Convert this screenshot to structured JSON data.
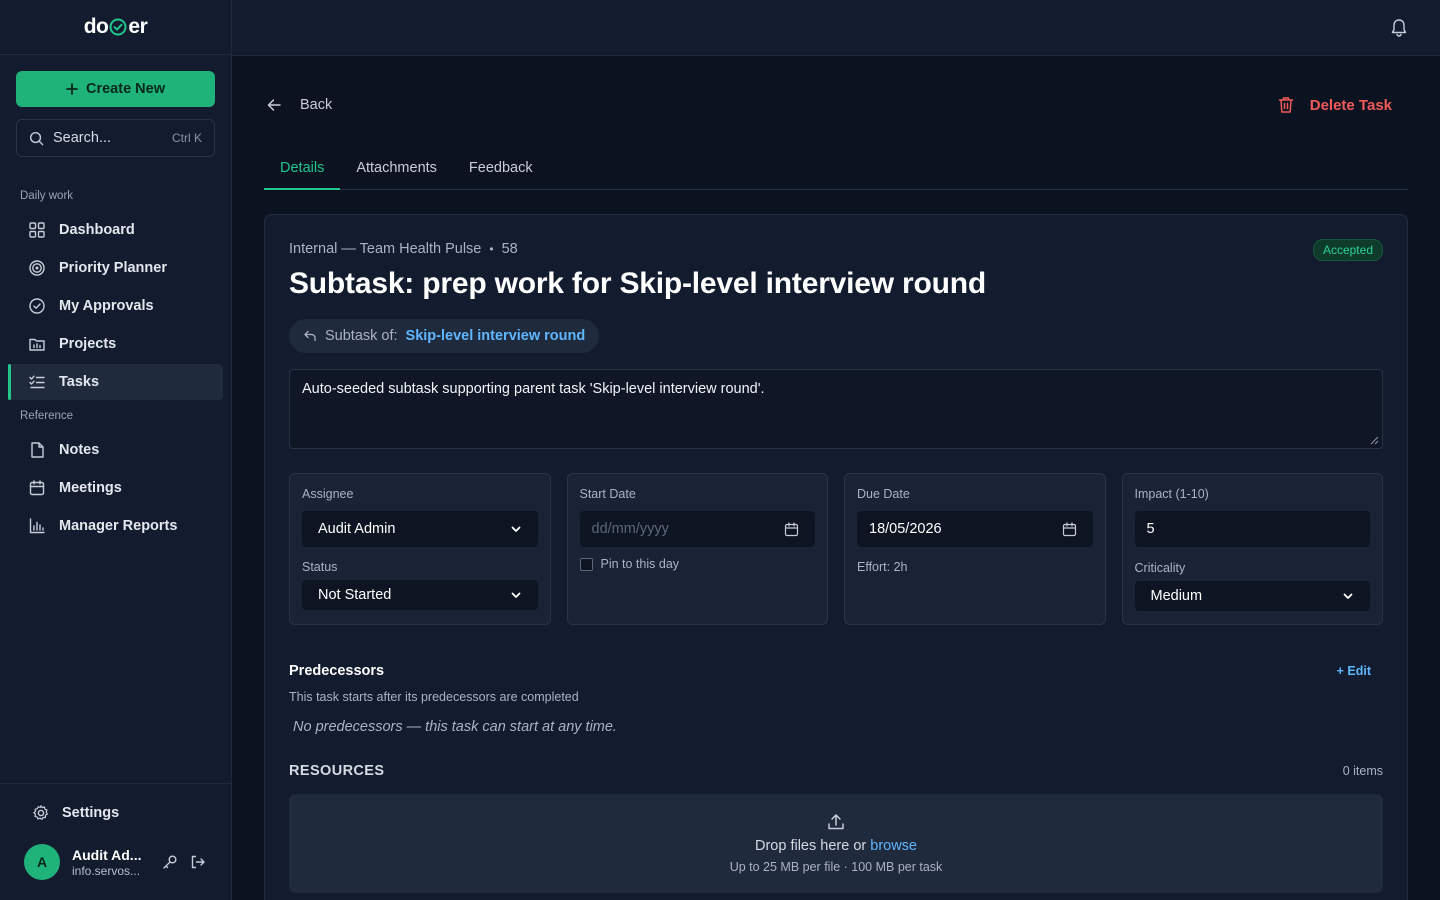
{
  "app": {
    "logo_left": "do",
    "logo_right": "er"
  },
  "sidebar": {
    "create_label": "Create New",
    "search_placeholder": "Search...",
    "search_shortcut": "Ctrl K",
    "section_daily": "Daily work",
    "section_reference": "Reference",
    "items": [
      {
        "label": "Dashboard",
        "icon": "grid-icon"
      },
      {
        "label": "Priority Planner",
        "icon": "target-icon"
      },
      {
        "label": "My Approvals",
        "icon": "check-circle-icon"
      },
      {
        "label": "Projects",
        "icon": "folder-icon"
      },
      {
        "label": "Tasks",
        "icon": "list-check-icon",
        "active": true
      },
      {
        "label": "Notes",
        "icon": "file-icon"
      },
      {
        "label": "Meetings",
        "icon": "calendar-icon"
      },
      {
        "label": "Manager Reports",
        "icon": "bar-chart-icon"
      }
    ],
    "settings_label": "Settings",
    "user": {
      "initial": "A",
      "name": "Audit Ad...",
      "email": "info.servos..."
    }
  },
  "page": {
    "back_label": "Back",
    "delete_label": "Delete Task",
    "tabs": [
      "Details",
      "Attachments",
      "Feedback"
    ],
    "active_tab": "Details"
  },
  "task": {
    "project": "Internal — Team Health Pulse",
    "number": "58",
    "status_badge": "Accepted",
    "title": "Subtask: prep work for Skip-level interview round",
    "parent_label": "Subtask of:",
    "parent_name": "Skip-level interview round",
    "description": "Auto-seeded subtask supporting parent task 'Skip-level interview round'."
  },
  "fields": {
    "assignee_label": "Assignee",
    "assignee_value": "Audit Admin",
    "status_label": "Status",
    "status_value": "Not Started",
    "start_label": "Start Date",
    "start_placeholder": "dd/mm/yyyy",
    "pin_label": "Pin to this day",
    "due_label": "Due Date",
    "due_value": "18/05/2026",
    "effort": "Effort: 2h",
    "impact_label": "Impact (1-10)",
    "impact_value": "5",
    "criticality_label": "Criticality",
    "criticality_value": "Medium"
  },
  "predecessors": {
    "title": "Predecessors",
    "edit_label": "+ Edit",
    "subtitle": "This task starts after its predecessors are completed",
    "empty": "No predecessors — this task can start at any time."
  },
  "resources": {
    "title": "RESOURCES",
    "count": "0 items",
    "drop_text": "Drop files here or",
    "browse": "browse",
    "limits": "Up to 25 MB per file · 100 MB per task"
  },
  "colors": {
    "accent": "#1fb37a",
    "danger": "#f05a5a",
    "link": "#5fb6ff"
  }
}
